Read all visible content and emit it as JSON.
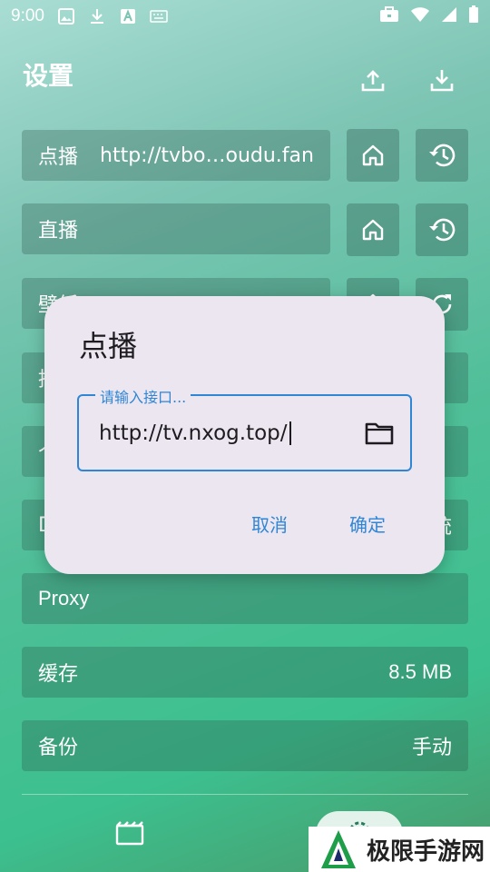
{
  "status_bar": {
    "time": "9:00"
  },
  "header": {
    "title": "设置"
  },
  "settings": {
    "vod": {
      "label": "点播",
      "value": "http://tvbo…oudu.fan/"
    },
    "live": {
      "label": "直播",
      "value": ""
    },
    "wallpaper": {
      "label": "壁纸"
    },
    "row4_char": "推",
    "row5_char": "个",
    "row6_char": "D",
    "row6_suffix": "统",
    "proxy": {
      "label": "Proxy"
    },
    "cache": {
      "label": "缓存",
      "value": "8.5 MB"
    },
    "backup": {
      "label": "备份",
      "value": "手动"
    }
  },
  "dialog": {
    "title": "点播",
    "field_label": "请输入接口...",
    "field_value": "http://tv.nxog.top/",
    "cancel": "取消",
    "confirm": "确定"
  },
  "watermark": {
    "text": "极限手游网"
  },
  "colors": {
    "accent": "#2f86d6",
    "dialog_bg": "#ece6f0"
  },
  "icons": [
    "upload-icon",
    "download-icon",
    "home-icon",
    "history-icon",
    "refresh-icon",
    "folder-icon",
    "movie-icon",
    "settings-icon"
  ]
}
